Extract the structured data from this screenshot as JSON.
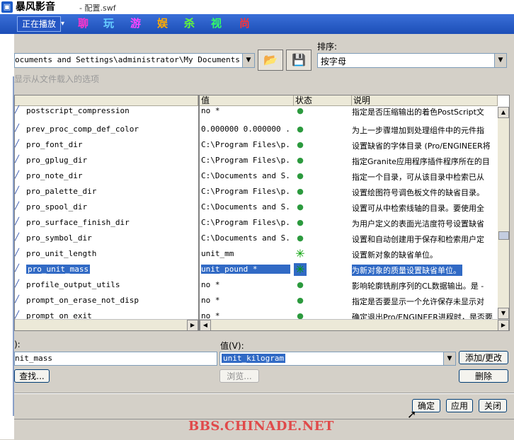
{
  "titlebar": {
    "app_name": "暴风影音",
    "sub": "- 配置.swf"
  },
  "player": {
    "now_playing": "正在播放",
    "dropdown_arrow": "▾",
    "nav": [
      {
        "label": "聊",
        "color": "#ff33cc"
      },
      {
        "label": "玩",
        "color": "#66ccff"
      },
      {
        "label": "游",
        "color": "#ff44ff"
      },
      {
        "label": "娱",
        "color": "#ffaa00"
      },
      {
        "label": "杀",
        "color": "#66ff33"
      },
      {
        "label": "视",
        "color": "#33ff66"
      },
      {
        "label": "尚",
        "color": "#ff3333"
      }
    ]
  },
  "toolbar": {
    "path": "ocuments and Settings\\administrator\\My Documents\\confi",
    "sort_label": "排序:",
    "sort_value": "按字母",
    "show_loaded": "显示从文件载入的选项"
  },
  "table": {
    "col_value": "值",
    "col_status": "状态",
    "col_desc": "说明",
    "rows": [
      {
        "name": "postscript_compression",
        "value": "no *",
        "desc": "指定是否压缩输出的着色PostScript文"
      },
      {
        "name": "prev_proc_comp_def_color",
        "value": "0.000000 0.000000 ...",
        "desc": "为上一步骤增加到处理组件中的元件指"
      },
      {
        "name": "pro_font_dir",
        "value": "C:\\Program Files\\p...",
        "desc": "设置缺省的字体目录 (Pro/ENGINEER将"
      },
      {
        "name": "pro_gplug_dir",
        "value": "C:\\Program Files\\p...",
        "desc": "指定Granite应用程序插件程序所在的目"
      },
      {
        "name": "pro_note_dir",
        "value": "C:\\Documents and S...",
        "desc": "指定一个目录，可从该目录中检索已从"
      },
      {
        "name": "pro_palette_dir",
        "value": "C:\\Program Files\\p...",
        "desc": "设置绘图符号调色板文件的缺省目录。"
      },
      {
        "name": "pro_spool_dir",
        "value": "C:\\Documents and S...",
        "desc": "设置可从中检索线轴的目录。要使用全"
      },
      {
        "name": "pro_surface_finish_dir",
        "value": "C:\\Program Files\\p...",
        "desc": "为用户定义的表面光洁度符号设置缺省"
      },
      {
        "name": "pro_symbol_dir",
        "value": "C:\\Documents and S...",
        "desc": "设置和自动创建用于保存和检索用户定"
      },
      {
        "name": "pro_unit_length",
        "value": "unit_mm",
        "desc": "设置新对象的缺省单位。"
      },
      {
        "name": "pro_unit_mass",
        "value": "unit_pound *",
        "desc": "为新对象的质量设置缺省单位。"
      },
      {
        "name": "profile_output_utils",
        "value": "no *",
        "desc": "影响轮廓铣削序列的CL数据输出。是 -"
      },
      {
        "name": "prompt_on_erase_not_disp",
        "value": "no *",
        "desc": "指定是否要显示一个允许保存未显示对"
      },
      {
        "name": "prompt_on_exit",
        "value": "no *",
        "desc": "确定退出Pro/ENGINEER进程时，是否要"
      }
    ]
  },
  "editor": {
    "name_label": "):",
    "name_value": "nit_mass",
    "value_label": "值(V):",
    "value_text": "unit_kilogram",
    "add_change": "添加/更改",
    "find": "查找...",
    "browse": "浏览...",
    "delete": "删除"
  },
  "footer": {
    "ok": "确定",
    "apply": "应用",
    "close": "关闭"
  },
  "watermark": "BBS.CHINADE.NET"
}
